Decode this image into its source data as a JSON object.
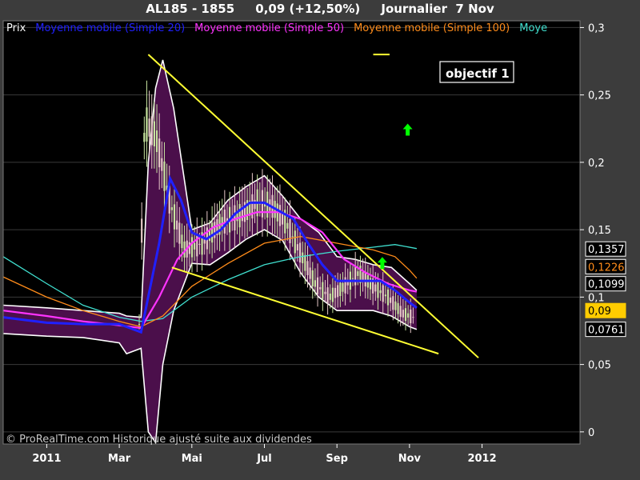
{
  "header": {
    "title": "AL185 - 1855     0,09 (+12,50%)     Journalier  7 Nov"
  },
  "watermark": "© ProRealTime.com Historique ajusté suite aux dividendes",
  "annotation": {
    "label": "objectif 1"
  },
  "colors": {
    "background": "#000000",
    "frame": "#3c3c3c",
    "axis_text": "#ffffff",
    "grid": "#3a3a3a",
    "band_fill": "#4b0f4b",
    "band_edge": "#ffffff",
    "trendline": "#ffff33",
    "arrow": "#00ff00",
    "candle_up": "#c8e6a0",
    "candle_down": "#e6c8c8"
  },
  "chart_data": {
    "type": "line",
    "title": "AL185 - 1855     0,09 (+12,50%)     Journalier  7 Nov",
    "xlabel": "",
    "ylabel": "",
    "x_ticks": [
      "2011",
      "Mar",
      "Mai",
      "Jul",
      "Sep",
      "Nov",
      "2012"
    ],
    "x_tick_positions": [
      0,
      2,
      4,
      6,
      8,
      10,
      12
    ],
    "x_range": [
      -1.2,
      14.7
    ],
    "ylim": [
      -0.009,
      0.305
    ],
    "y_ticks": [
      0,
      0.05,
      0.1,
      0.15,
      0.2,
      0.25,
      0.3
    ],
    "y_tick_labels": [
      "0",
      "0,05",
      "0,1",
      "0,15",
      "0,2",
      "0,25",
      "0,3"
    ],
    "grid": true,
    "legend_position": "top-left",
    "legend": [
      {
        "name": "Prix",
        "color": "#ffffff"
      },
      {
        "name": "Moyenne mobile (Simple 20)",
        "color": "#2020ff"
      },
      {
        "name": "Moyenne mobile (Simple 50)",
        "color": "#ff33ff"
      },
      {
        "name": "Moyenne mobile (Simple 100)",
        "color": "#ff8c1a"
      },
      {
        "name": "Moye",
        "color": "#40e0d0"
      }
    ],
    "series": [
      {
        "name": "Moyenne mobile (Simple 20)",
        "color": "#2020ff",
        "x": [
          -1.2,
          0,
          1,
          2,
          2.6,
          3.1,
          3.4,
          3.7,
          4,
          4.4,
          4.8,
          5.2,
          5.6,
          6,
          6.4,
          6.8,
          7.2,
          7.6,
          8,
          8.4,
          8.8,
          9.2,
          9.6,
          10,
          10.2
        ],
        "y": [
          0.085,
          0.081,
          0.08,
          0.08,
          0.074,
          0.14,
          0.188,
          0.172,
          0.148,
          0.143,
          0.15,
          0.162,
          0.17,
          0.17,
          0.164,
          0.158,
          0.14,
          0.124,
          0.112,
          0.112,
          0.112,
          0.112,
          0.105,
          0.096,
          0.092
        ]
      },
      {
        "name": "Moyenne mobile (Simple 50)",
        "color": "#ff33ff",
        "x": [
          -1.2,
          0,
          1,
          2,
          2.6,
          3.1,
          3.6,
          4,
          4.6,
          5.2,
          5.8,
          6.4,
          7,
          7.6,
          8.2,
          8.8,
          9.4,
          10,
          10.2
        ],
        "y": [
          0.09,
          0.086,
          0.082,
          0.079,
          0.077,
          0.1,
          0.128,
          0.14,
          0.152,
          0.158,
          0.163,
          0.163,
          0.158,
          0.148,
          0.128,
          0.118,
          0.11,
          0.105,
          0.104
        ]
      },
      {
        "name": "Moyenne mobile (Simple 100)",
        "color": "#ff8c1a",
        "x": [
          -1.2,
          0,
          1,
          2,
          2.6,
          3.2,
          4,
          5,
          6,
          7,
          8,
          9,
          9.6,
          10,
          10.2
        ],
        "y": [
          0.115,
          0.1,
          0.09,
          0.082,
          0.078,
          0.086,
          0.108,
          0.125,
          0.14,
          0.145,
          0.14,
          0.135,
          0.13,
          0.12,
          0.114
        ]
      },
      {
        "name": "Moye",
        "color": "#40e0d0",
        "x": [
          -1.2,
          0,
          1,
          2,
          2.6,
          3.2,
          4,
          5,
          6,
          7,
          8,
          9,
          9.6,
          10.2
        ],
        "y": [
          0.13,
          0.11,
          0.094,
          0.085,
          0.082,
          0.084,
          0.1,
          0.113,
          0.124,
          0.13,
          0.134,
          0.137,
          0.139,
          0.136
        ]
      }
    ],
    "bollinger_band": {
      "x": [
        -1.2,
        0,
        1,
        2,
        2.2,
        2.6,
        2.8,
        3,
        3.2,
        3.5,
        4,
        4.5,
        5,
        5.5,
        6,
        6.5,
        7,
        7.5,
        8,
        8.5,
        9,
        9.5,
        10,
        10.2
      ],
      "upper": [
        0.094,
        0.092,
        0.09,
        0.088,
        0.086,
        0.085,
        0.2,
        0.255,
        0.276,
        0.24,
        0.15,
        0.155,
        0.172,
        0.182,
        0.19,
        0.175,
        0.158,
        0.148,
        0.13,
        0.128,
        0.124,
        0.122,
        0.11,
        0.105
      ],
      "lower": [
        0.073,
        0.071,
        0.07,
        0.066,
        0.058,
        0.062,
        0.0,
        -0.008,
        0.05,
        0.09,
        0.125,
        0.124,
        0.133,
        0.143,
        0.15,
        0.142,
        0.118,
        0.1,
        0.09,
        0.09,
        0.09,
        0.086,
        0.078,
        0.076
      ]
    },
    "trendlines": [
      {
        "x1": 2.8,
        "y1": 0.28,
        "x2": 11.9,
        "y2": 0.055
      },
      {
        "x1": 3.45,
        "y1": 0.122,
        "x2": 10.8,
        "y2": 0.058
      }
    ],
    "annotation_line": {
      "x1": 9.0,
      "y1": 0.28,
      "x2": 9.45,
      "y2": 0.28
    },
    "arrows": [
      {
        "x": 9.95,
        "y": 0.224
      },
      {
        "x": 9.25,
        "y": 0.125
      }
    ],
    "candles": {
      "x_start": 2.55,
      "x_end": 10.1,
      "count": 110,
      "price_path_x": [
        2.55,
        2.7,
        3.0,
        3.4,
        3.8,
        4.3,
        4.8,
        5.3,
        5.8,
        6.2,
        6.6,
        7.0,
        7.4,
        7.8,
        8.2,
        8.6,
        9.0,
        9.4,
        9.8,
        10.1
      ],
      "price_path_y": [
        0.08,
        0.23,
        0.22,
        0.17,
        0.135,
        0.14,
        0.155,
        0.16,
        0.17,
        0.168,
        0.155,
        0.132,
        0.11,
        0.1,
        0.108,
        0.118,
        0.108,
        0.1,
        0.088,
        0.085
      ]
    },
    "price_labels": [
      {
        "value": 0.1357,
        "text": "0,1357",
        "color": "#ffffff",
        "bg": "#000000",
        "border": "#ffffff"
      },
      {
        "value": 0.1226,
        "text": "0,1226",
        "color": "#ff8c1a",
        "bg": "#000000",
        "border": "#ffffff"
      },
      {
        "value": 0.1099,
        "text": "0,1099",
        "color": "#ffffff",
        "bg": "#000000",
        "border": "#ffffff"
      },
      {
        "value": 0.09,
        "text": "0,09",
        "color": "#000000",
        "bg": "#ffcc00",
        "border": "#ffcc00"
      },
      {
        "value": 0.0761,
        "text": "0,0761",
        "color": "#ffffff",
        "bg": "#000000",
        "border": "#ffffff"
      }
    ]
  }
}
